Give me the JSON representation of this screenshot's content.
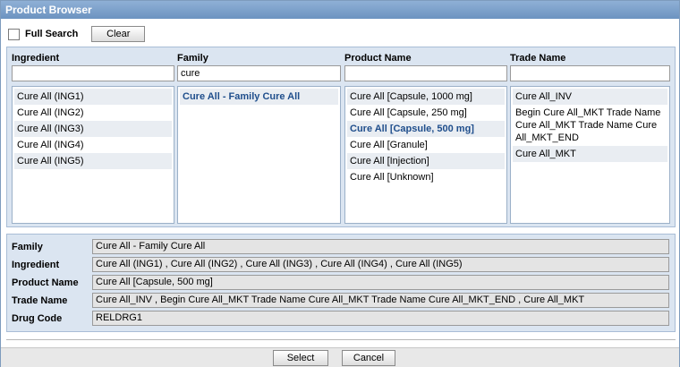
{
  "window": {
    "title": "Product Browser"
  },
  "search": {
    "full_search_label": "Full Search",
    "full_search_checked": false,
    "clear_label": "Clear"
  },
  "columns": {
    "ingredient": {
      "header": "Ingredient",
      "filter": "",
      "items": [
        "Cure All (ING1)",
        "Cure All (ING2)",
        "Cure All (ING3)",
        "Cure All (ING4)",
        "Cure All (ING5)"
      ]
    },
    "family": {
      "header": "Family",
      "filter": "cure",
      "items": [
        "Cure All - Family Cure All"
      ]
    },
    "product": {
      "header": "Product Name",
      "filter": "",
      "items": [
        "Cure All [Capsule, 1000 mg]",
        "Cure All [Capsule, 250 mg]",
        "Cure All [Capsule, 500 mg]",
        "Cure All [Granule]",
        "Cure All [Injection]",
        "Cure All [Unknown]"
      ]
    },
    "trade": {
      "header": "Trade Name",
      "filter": "",
      "items": [
        "Cure All_INV",
        "Begin Cure All_MKT Trade Name Cure All_MKT Trade Name Cure All_MKT_END",
        "Cure All_MKT"
      ]
    }
  },
  "details": {
    "family_label": "Family",
    "family_value": "Cure All - Family Cure All",
    "ingredient_label": "Ingredient",
    "ingredient_value": "Cure All (ING1) , Cure All (ING2) , Cure All (ING3) , Cure All (ING4) , Cure All (ING5)",
    "product_label": "Product Name",
    "product_value": "Cure All [Capsule, 500 mg]",
    "trade_label": "Trade Name",
    "trade_value": "Cure All_INV , Begin Cure All_MKT Trade Name Cure All_MKT Trade Name Cure All_MKT_END , Cure All_MKT",
    "drug_code_label": "Drug Code",
    "drug_code_value": "RELDRG1"
  },
  "footer": {
    "select_label": "Select",
    "cancel_label": "Cancel"
  },
  "colors": {
    "title_bar": "#7fa2cc",
    "panel": "#dbe5f1",
    "selected_text": "#1f4e8c"
  }
}
